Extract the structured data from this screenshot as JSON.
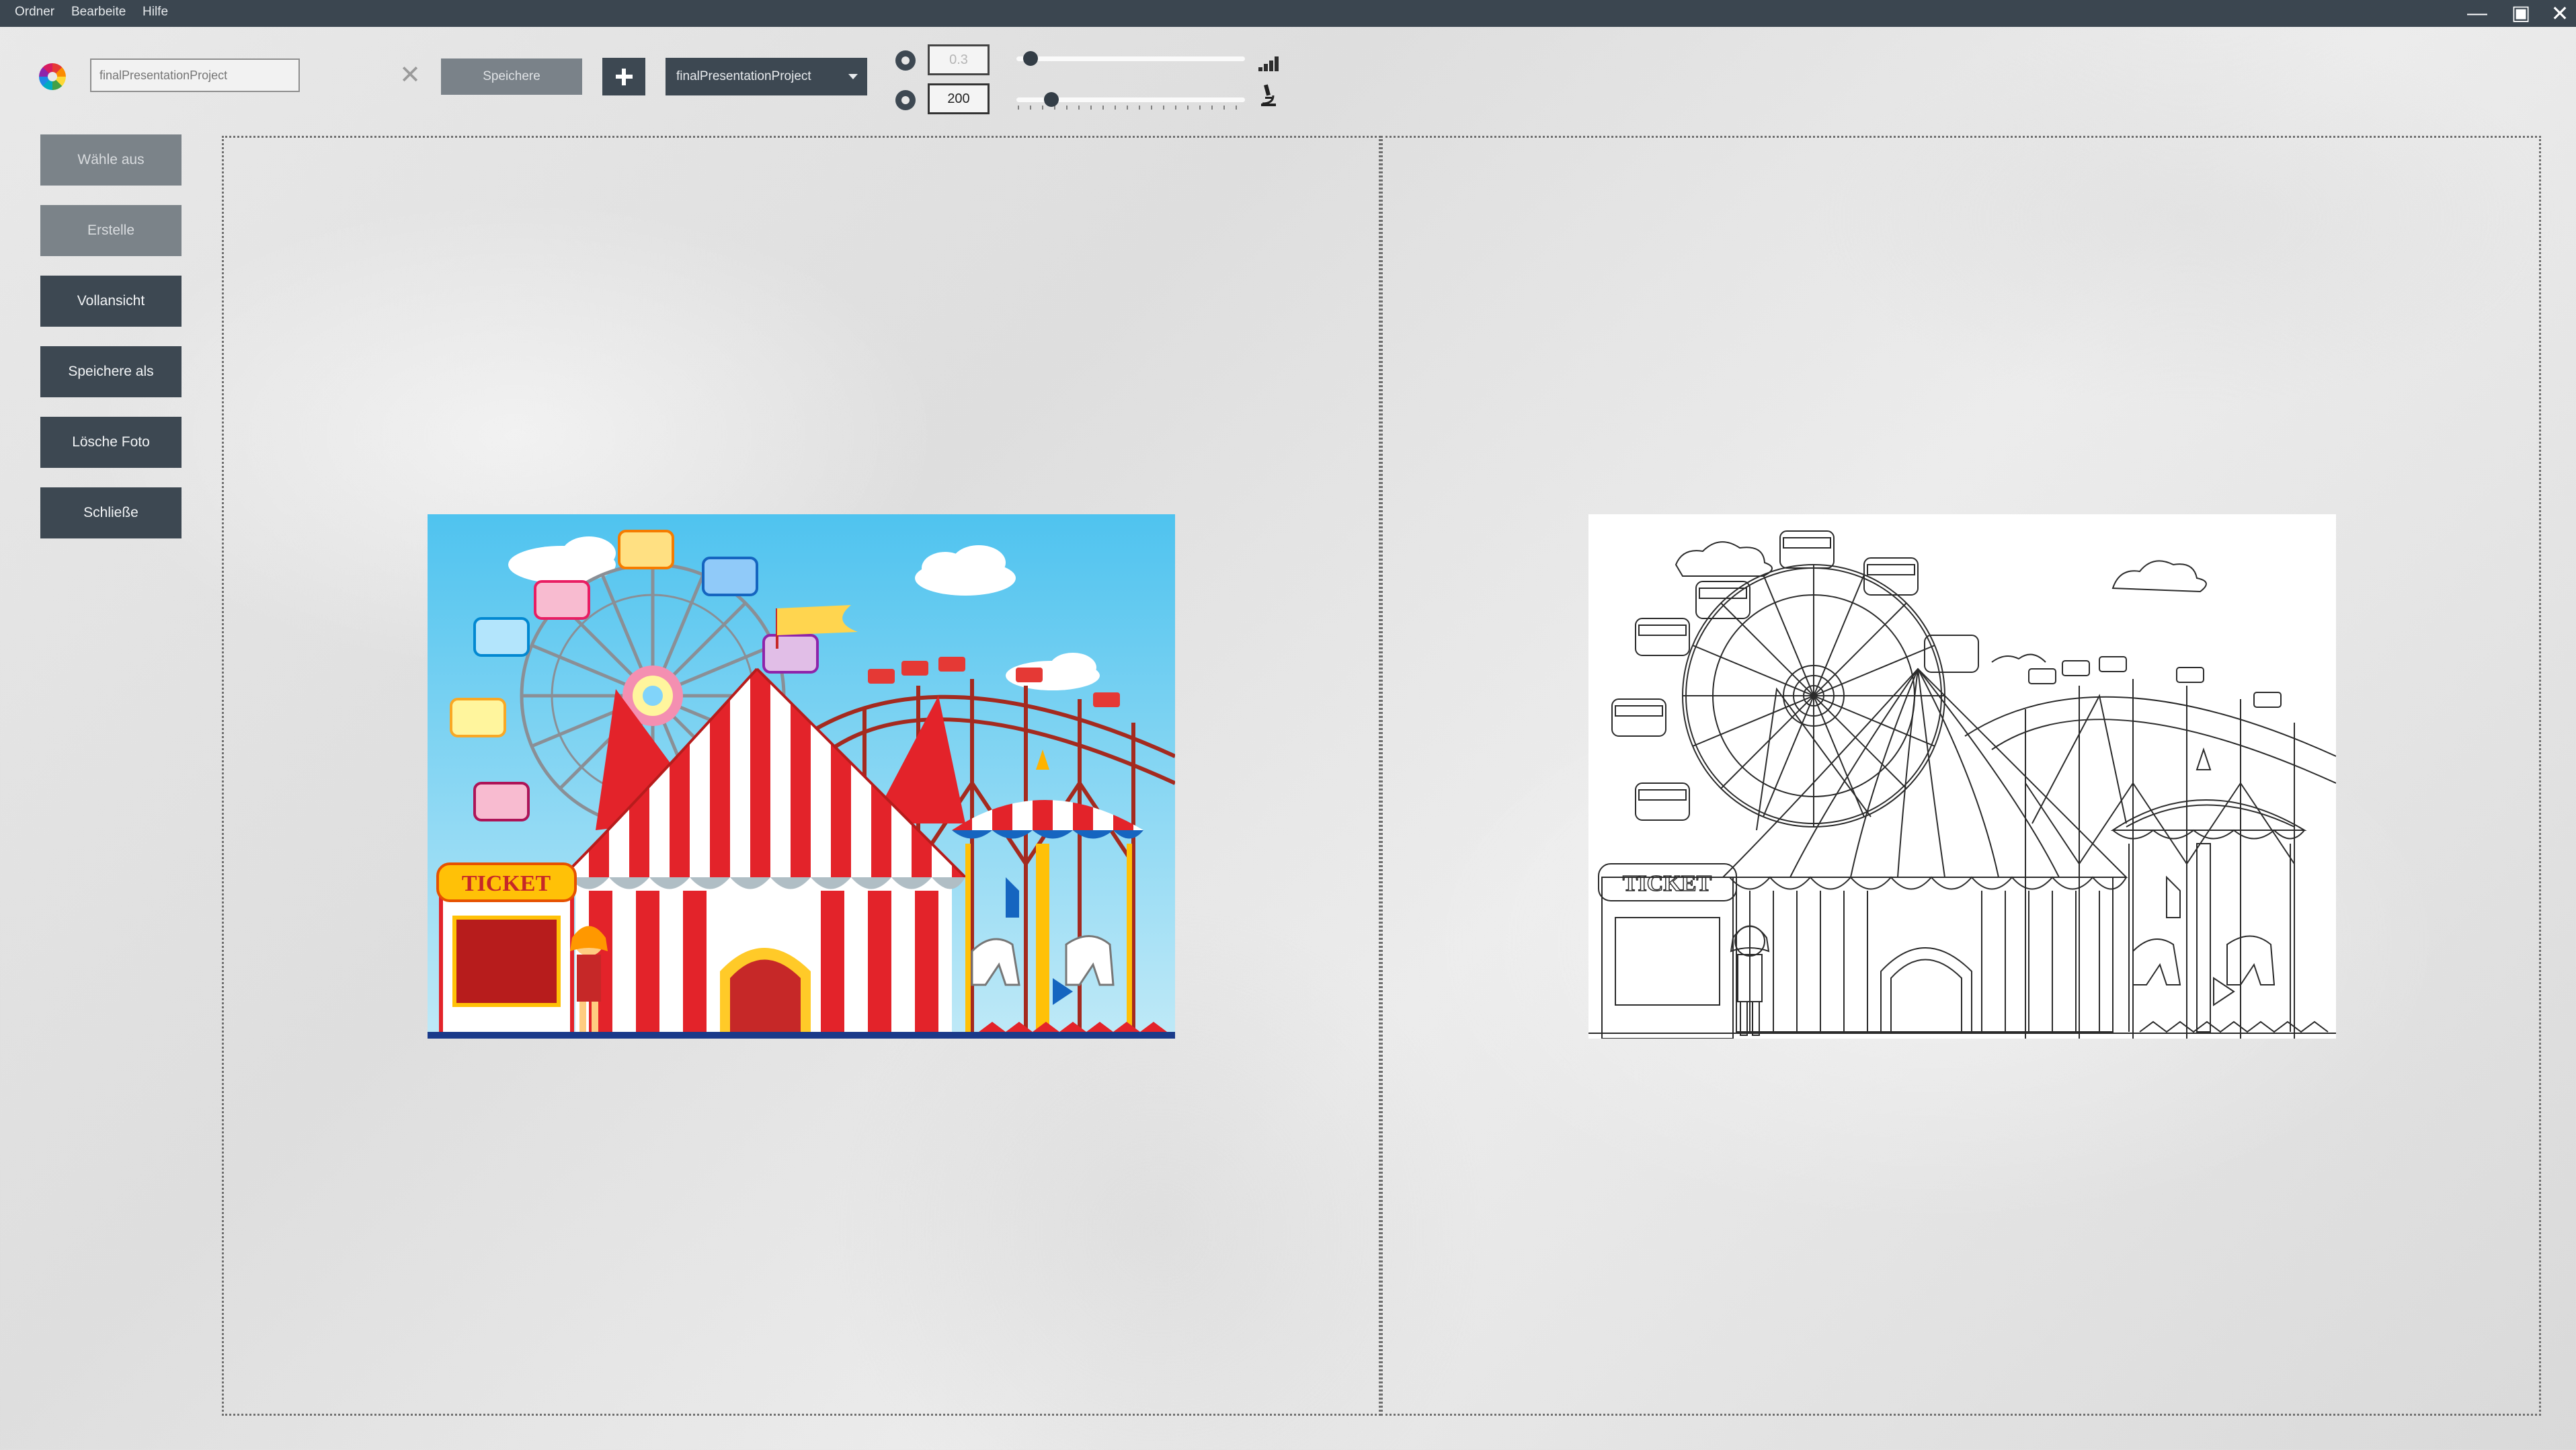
{
  "menu": {
    "items": [
      "Ordner",
      "Bearbeite",
      "Hilfe"
    ]
  },
  "window_controls": {
    "minimize": "—",
    "maximize": "▣",
    "close": "✕"
  },
  "toolbar": {
    "project_placeholder": "finalPresentationProject",
    "clear_icon": "✕",
    "save_label": "Speichere",
    "dropdown_selected": "finalPresentationProject",
    "field1_value": "0.3",
    "field2_value": "200",
    "slider1_level": 0.03,
    "slider2_level": 0.12
  },
  "sidebar": {
    "items": [
      {
        "label": "Wähle aus",
        "enabled": false
      },
      {
        "label": "Erstelle",
        "enabled": false
      },
      {
        "label": "Vollansicht",
        "enabled": true
      },
      {
        "label": "Speichere als",
        "enabled": true
      },
      {
        "label": "Lösche Foto",
        "enabled": true
      },
      {
        "label": "Schließe",
        "enabled": true
      }
    ]
  },
  "left_image": {
    "ticket_sign": "TICKET"
  },
  "right_image": {
    "ticket_sign": "TICKET"
  },
  "colors": {
    "titlebar": "#3b4650",
    "button_dark": "#3d4852",
    "button_disabled": "#7b8389"
  }
}
